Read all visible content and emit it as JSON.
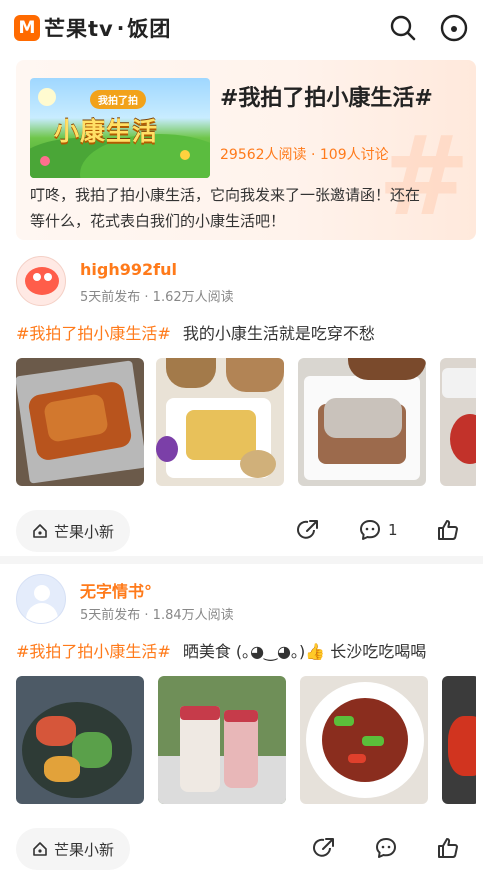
{
  "app": {
    "logo_mark": "M",
    "brand": "芒果tv",
    "dot": "·",
    "section": "饭团"
  },
  "header": {
    "search_icon": "search-icon",
    "profile_icon": "smiley-icon"
  },
  "topic": {
    "banner_badge": "我拍了拍",
    "banner_title": "小康生活",
    "title": "#我拍了拍小康生活#",
    "stats": "29562人阅读 · 109人讨论",
    "description": "叮咚，我拍了拍小康生活，它向我发来了一张邀请函！还在等什么，花式表白我们的小康生活吧！"
  },
  "posts": [
    {
      "username": "high992ful",
      "meta": "5天前发布 · 1.62万人阅读",
      "tag": "#我拍了拍小康生活#",
      "text": "我的小康生活就是吃穿不愁",
      "chip": "芒果小新",
      "comments": "1",
      "photos": [
        "roast-goose",
        "dim-sum-chicken",
        "rice-noodle-roll",
        "cold-dish"
      ]
    },
    {
      "username": "无字情书°",
      "meta": "5天前发布 · 1.84万人阅读",
      "tag": "#我拍了拍小康生活#",
      "text": "晒美食 (｡◕‿◕｡)👍 长沙吃吃喝喝",
      "chip": "芒果小新",
      "comments": "",
      "photos": [
        "salad-bowl",
        "milk-tea",
        "stir-fried-beef",
        "crayfish"
      ]
    }
  ],
  "colors": {
    "accent": "#ff7a1a",
    "brand": "#ff6a00"
  }
}
